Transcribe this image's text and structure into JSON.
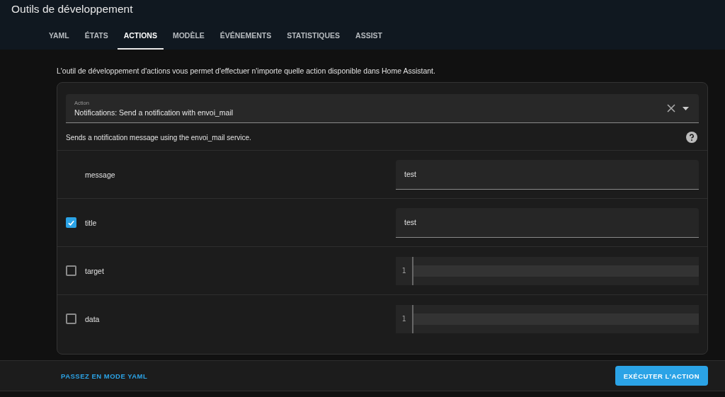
{
  "header": {
    "title": "Outils de développement"
  },
  "tabs": [
    {
      "label": "YAML",
      "selected": false
    },
    {
      "label": "ÉTATS",
      "selected": false
    },
    {
      "label": "ACTIONS",
      "selected": true
    },
    {
      "label": "MODÈLE",
      "selected": false
    },
    {
      "label": "ÉVÉNEMENTS",
      "selected": false
    },
    {
      "label": "STATISTIQUES",
      "selected": false
    },
    {
      "label": "ASSIST",
      "selected": false
    }
  ],
  "intro": "L'outil de développement d'actions vous permet d'effectuer n'importe quelle action disponible dans Home Assistant.",
  "action_select": {
    "label": "Action",
    "value": "Notifications: Send a notification with envoi_mail"
  },
  "description": "Sends a notification message using the envoi_mail service.",
  "fields": [
    {
      "name": "message",
      "kind": "text",
      "value": "test"
    },
    {
      "name": "title",
      "kind": "text",
      "checked": true,
      "value": "test"
    },
    {
      "name": "target",
      "kind": "code",
      "checked": false,
      "line_number": "1"
    },
    {
      "name": "data",
      "kind": "code",
      "checked": false,
      "line_number": "1"
    }
  ],
  "footer": {
    "link": "PASSEZ EN MODE YAML",
    "button": "EXÉCUTER L'ACTION"
  }
}
